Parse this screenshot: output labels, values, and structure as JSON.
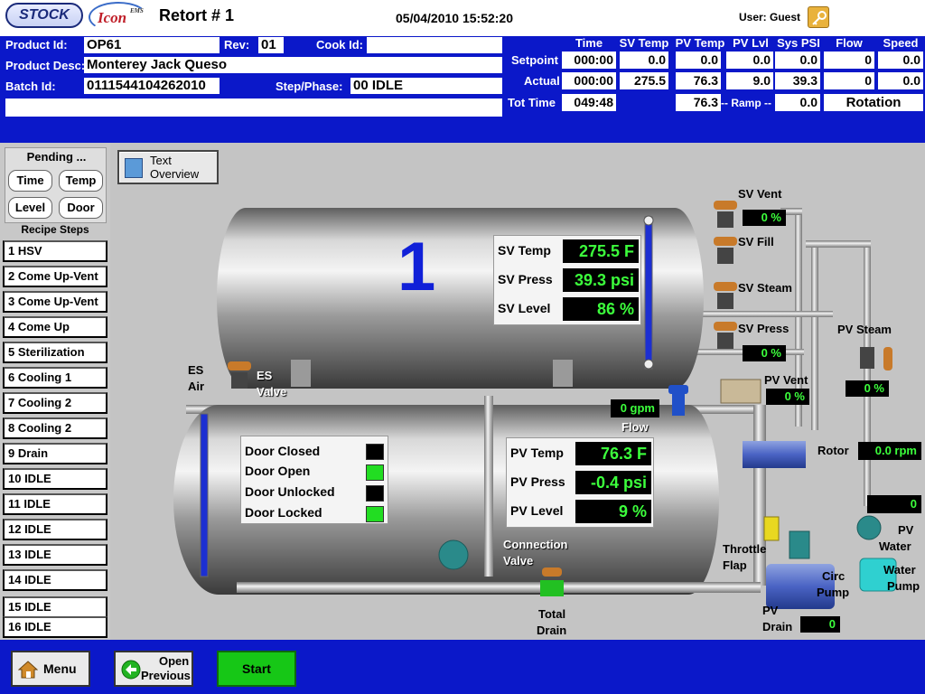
{
  "title": {
    "logo_stock": "STOCK",
    "logo_icon": "Icon",
    "logo_icon_sup": "EMS",
    "retort": "Retort # 1",
    "datetime": "05/04/2010 15:52:20",
    "user": "User: Guest"
  },
  "info": {
    "product_id_label": "Product Id:",
    "product_id": "OP61",
    "rev_label": "Rev:",
    "rev": "01",
    "cook_id_label": "Cook Id:",
    "cook_id": "",
    "product_desc_label": "Product Desc:",
    "product_desc": "Monterey Jack Queso",
    "batch_id_label": "Batch Id:",
    "batch_id": "0111544104262010",
    "step_phase_label": "Step/Phase:",
    "step_phase": "00 IDLE",
    "message": ""
  },
  "process": {
    "columns": [
      "Time",
      "SV Temp",
      "PV Temp",
      "PV Lvl",
      "Sys PSI",
      "Flow",
      "Speed"
    ],
    "setpoint_label": "Setpoint",
    "actual_label": "Actual",
    "tot_time_label": "Tot Time",
    "ramp_label": "-- Ramp --",
    "setpoint": [
      "000:00",
      "0.0",
      "0.0",
      "0.0",
      "0.0",
      "0",
      "0.0"
    ],
    "actual": [
      "000:00",
      "275.5",
      "76.3",
      "9.0",
      "39.3",
      "0",
      "0.0"
    ],
    "tot_time": "049:48",
    "tot_pv_temp": "76.3",
    "ramp": "0.0",
    "rotation": "Rotation"
  },
  "pending": {
    "title": "Pending ...",
    "time": "Time",
    "temp": "Temp",
    "level": "Level",
    "door": "Door"
  },
  "recipe": {
    "title": "Recipe Steps",
    "steps": [
      "1 HSV",
      "2 Come Up-Vent",
      "3 Come Up-Vent",
      "4 Come Up",
      "5 Sterilization",
      "6 Cooling 1",
      "7 Cooling 2",
      "8 Cooling 2",
      "9 Drain",
      "10 IDLE",
      "11 IDLE",
      "12 IDLE",
      "13 IDLE",
      "14 IDLE",
      "15 IDLE",
      "16 IDLE"
    ]
  },
  "graphic": {
    "text_overview_1": "Text",
    "text_overview_2": "Overview",
    "vessel_number": "1",
    "sv_temp_label": "SV Temp",
    "sv_temp": "275.5 F",
    "sv_press_label": "SV Press",
    "sv_press": "39.3 psi",
    "sv_level_label": "SV Level",
    "sv_level": "86 %",
    "pv_temp_label": "PV Temp",
    "pv_temp": "76.3 F",
    "pv_press_label": "PV Press",
    "pv_press": "-0.4 psi",
    "pv_level_label": "PV Level",
    "pv_level": "9 %",
    "door_closed": "Door Closed",
    "door_open": "Door Open",
    "door_unlocked": "Door Unlocked",
    "door_locked": "Door Locked",
    "sv_vent": "SV Vent",
    "sv_vent_value": "0 %",
    "sv_fill": "SV Fill",
    "sv_steam": "SV Steam",
    "sv_press_valve": "SV Press",
    "sv_press_valve_value": "0 %",
    "pv_steam": "PV Steam",
    "pv_steam_value": "0 %",
    "pv_vent": "PV Vent",
    "pv_vent_value": "0 %",
    "es_air_1": "ES",
    "es_air_2": "Air",
    "es_valve_1": "ES",
    "es_valve_2": "Valve",
    "flow_value": "0 gpm",
    "flow_label": "Flow",
    "rotor_label": "Rotor",
    "rotor_value": "0.0 rpm",
    "pv_water_value": "0",
    "pv_water_1": "PV",
    "pv_water_2": "Water",
    "water_pump_1": "Water",
    "water_pump_2": "Pump",
    "throttle_1": "Throttle",
    "throttle_2": "Flap",
    "circ_1": "Circ",
    "circ_2": "Pump",
    "connection_1": "Connection",
    "connection_2": "Valve",
    "total_drain_1": "Total",
    "total_drain_2": "Drain",
    "pv_drain_1": "PV",
    "pv_drain_2": "Drain",
    "pv_drain_value": "0"
  },
  "bottom": {
    "menu": "Menu",
    "open_previous_1": "Open",
    "open_previous_2": "Previous",
    "start": "Start"
  },
  "colors": {
    "header_blue": "#0b18c9",
    "readout_green": "#3cff3c",
    "indicator_on": "#22dd22",
    "start_green": "#16c716"
  }
}
